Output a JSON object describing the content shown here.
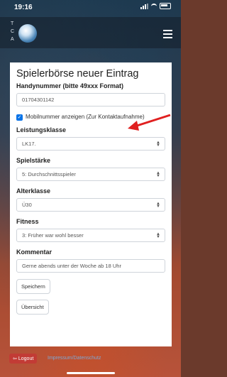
{
  "status_bar": {
    "time": "19:16"
  },
  "header": {
    "logo_letters": [
      "T",
      "C",
      "A"
    ]
  },
  "form": {
    "title": "Spielerbörse neuer Eintrag",
    "phone": {
      "label": "Handynummer (bitte 49xxx Format)",
      "value": "01704301142"
    },
    "show_mobile": {
      "checked": true,
      "label": "Mobilnummer anzeigen (Zur Kontaktaufnahme)"
    },
    "leistungsklasse": {
      "label": "Leistungsklasse",
      "value": "LK17."
    },
    "spielstaerke": {
      "label": "Spielstärke",
      "value": "5: Durchschnittsspieler"
    },
    "alterklasse": {
      "label": "Alterklasse",
      "value": "Ü30"
    },
    "fitness": {
      "label": "Fitness",
      "value": "3: Früher war wohl besser"
    },
    "kommentar": {
      "label": "Kommentar",
      "value": "Gerne abends unter der Woche ab 18 Uhr"
    },
    "save_label": "Speichern",
    "overview_label": "Übersicht"
  },
  "footer": {
    "logout_label": "Logout",
    "impressum_label": "Impressum/Datenschutz"
  },
  "colors": {
    "accent": "#0a74e8",
    "logout": "#c23b35",
    "annotation_arrow": "#e02020"
  }
}
